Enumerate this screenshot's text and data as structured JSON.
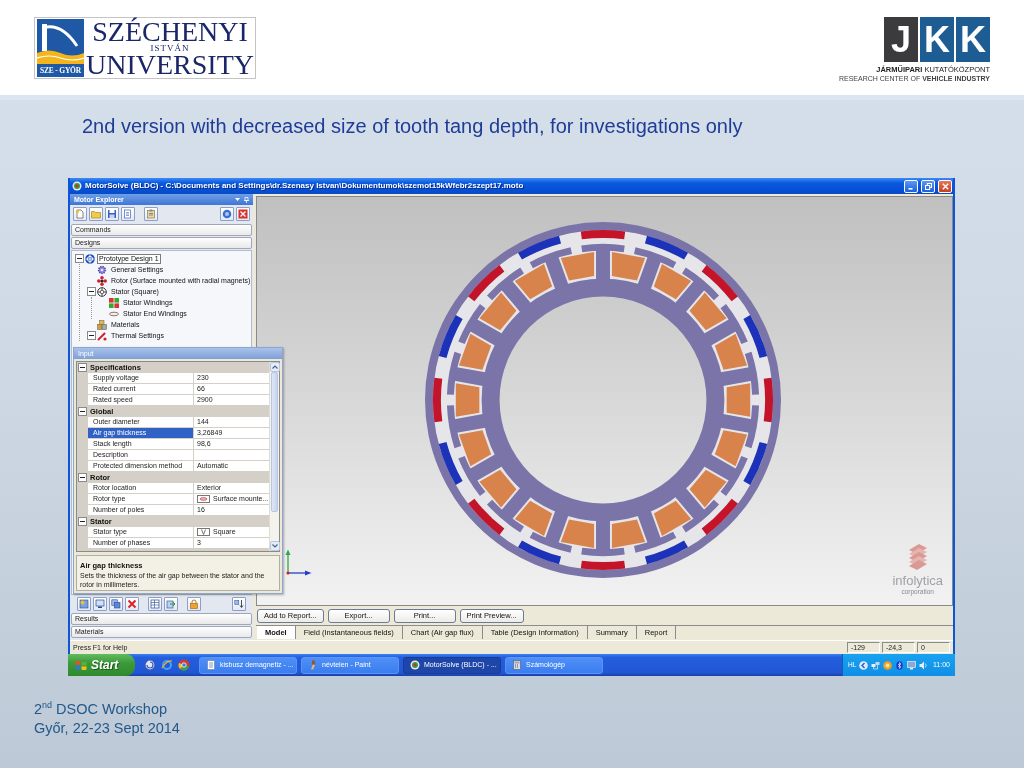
{
  "header": {
    "university_logo": {
      "badge": "SZE - GYŐR",
      "name_top": "SZÉCHENYI",
      "name_middle": "ISTVÁN",
      "name_bottom": "UNIVERSITY"
    },
    "institute_logo": {
      "letters": [
        "J",
        "K",
        "K"
      ],
      "name": "**JÁRMŰIPARI** KUTATÓKÖZPONT",
      "subtitle": "RESEARCH CENTER OF **VEHICLE INDUSTRY**"
    }
  },
  "slide_title": "2nd version with decreased size of tooth tang depth, for investigations only",
  "app": {
    "title": "MotorSolve (BLDC) - C:\\Documents and Settings\\dr.Szenasy Istvan\\Dokumentumok\\szemot15kWfebr2szept17.moto",
    "explorer": {
      "title": "Motor Explorer",
      "sections_top": [
        "Commands",
        "Designs"
      ],
      "tree": [
        {
          "label": "Prototype Design 1",
          "kind": "design",
          "selected": true,
          "expanded": true,
          "children": [
            {
              "label": "General Settings",
              "kind": "settings",
              "selected": false
            },
            {
              "label": "Rotor (Surface mounted with radial magnets)",
              "kind": "rotor",
              "selected": false
            },
            {
              "label": "Stator (Square)",
              "kind": "stator",
              "selected": false,
              "expanded": true,
              "children": [
                {
                  "label": "Stator Windings",
                  "kind": "windings",
                  "selected": false
                },
                {
                  "label": "Stator End Windings",
                  "kind": "end-windings",
                  "selected": false
                }
              ]
            },
            {
              "label": "Materials",
              "kind": "materials",
              "selected": false
            },
            {
              "label": "Thermal Settings",
              "kind": "thermal",
              "selected": false,
              "expanded": true
            }
          ]
        }
      ],
      "sections_bottom": [
        "Results",
        "Materials"
      ]
    },
    "input_panel": {
      "title": "Input",
      "categories": [
        {
          "label": "Specifications",
          "expanded": true,
          "properties": [
            {
              "name": "Supply voltage",
              "value": "230",
              "kind": "text",
              "selected": false
            },
            {
              "name": "Rated current",
              "value": "66",
              "kind": "text",
              "selected": false
            },
            {
              "name": "Rated speed",
              "value": "2900",
              "kind": "text",
              "selected": false
            }
          ]
        },
        {
          "label": "Global",
          "expanded": true,
          "properties": [
            {
              "name": "Outer diameter",
              "value": "144",
              "kind": "text",
              "selected": false
            },
            {
              "name": "Air gap thickness",
              "value": "3,26849",
              "kind": "text",
              "selected": true
            },
            {
              "name": "Stack length",
              "value": "98,6",
              "kind": "text",
              "selected": false
            },
            {
              "name": "Description",
              "kind": "text",
              "selected": false
            },
            {
              "name": "Protected dimension method",
              "value": "Automatic",
              "kind": "text",
              "selected": false
            }
          ]
        },
        {
          "label": "Rotor",
          "expanded": true,
          "properties": [
            {
              "name": "Rotor location",
              "value": "Exterior",
              "kind": "text",
              "selected": false
            },
            {
              "name": "Rotor type",
              "value": "Surface mounte...",
              "kind": "rotor-symbol",
              "selected": false
            },
            {
              "name": "Number of poles",
              "value": "16",
              "kind": "text",
              "selected": false
            }
          ]
        },
        {
          "label": "Stator",
          "expanded": true,
          "properties": [
            {
              "name": "Stator type",
              "value": "Square",
              "kind": "stator-symbol",
              "selected": false
            },
            {
              "name": "Number of phases",
              "value": "3",
              "kind": "text",
              "selected": false
            }
          ]
        }
      ],
      "help": {
        "title": "Air gap thickness",
        "text": "Sets the thickness of the air gap between the stator and the rotor in millimeters."
      }
    },
    "viewport": {
      "logo": {
        "name": "infolytica",
        "tagline": "corporation"
      }
    },
    "report_buttons": [
      "Add to Report...",
      "Export...",
      "Print...",
      "Print Preview..."
    ],
    "tabs": [
      {
        "label": "Model",
        "selected": true
      },
      {
        "label": "Field (Instantaneous fields)",
        "selected": false
      },
      {
        "label": "Chart (Air gap flux)",
        "selected": false
      },
      {
        "label": "Table (Design Information)",
        "selected": false
      },
      {
        "label": "Summary",
        "selected": false
      },
      {
        "label": "Report",
        "selected": false
      }
    ],
    "status_bar": {
      "text": "Press F1 for Help",
      "fields": [
        "-129",
        "-24,3",
        "0"
      ]
    }
  },
  "taskbar": {
    "start": "Start",
    "tasks": [
      {
        "label": "kisbusz demagnetiz - ...",
        "kind": "document",
        "selected": false
      },
      {
        "label": "névtelen - Paint",
        "kind": "paint",
        "selected": false
      },
      {
        "label": "MotorSolve (BLDC) - ...",
        "kind": "motorsolve",
        "selected": true
      },
      {
        "label": "Számológép",
        "kind": "calculator",
        "selected": false
      }
    ],
    "tray": {
      "language": "HL",
      "clock": "11:00"
    }
  },
  "footer": {
    "lines": [
      "2$^{nd}$ DSOC Workshop",
      "Győr, 22-23 Sept 2014"
    ]
  }
}
